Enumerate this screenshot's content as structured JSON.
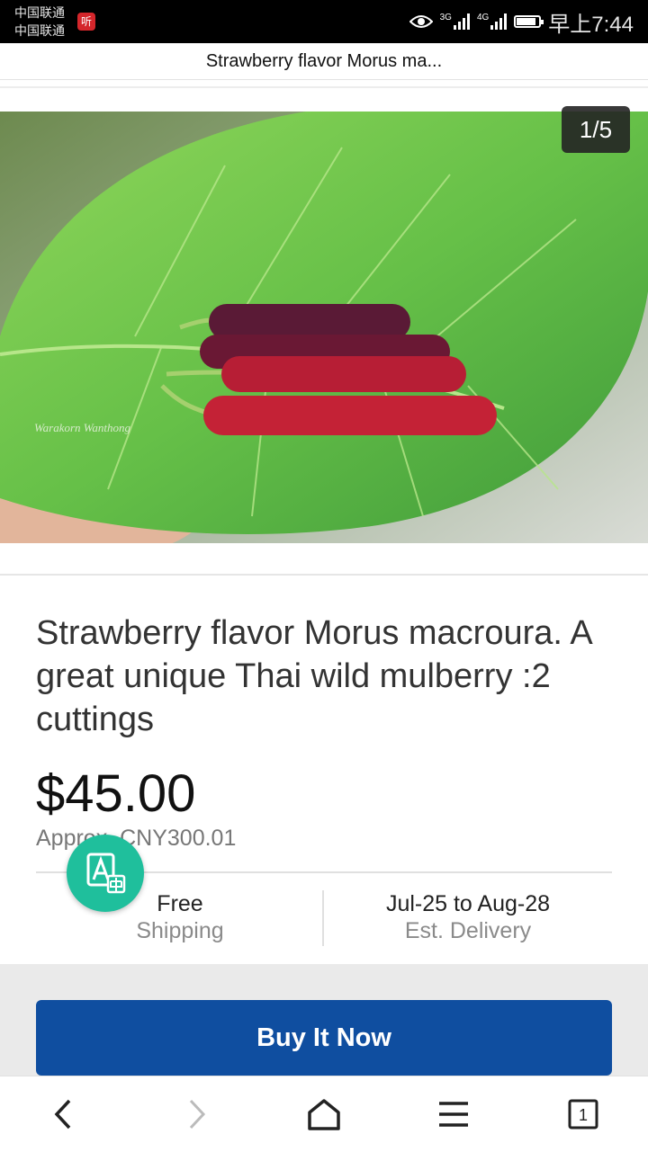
{
  "status_bar": {
    "carrier_1": "中国联通",
    "carrier_2": "中国联通",
    "listen_badge": "听",
    "network_1": "3G",
    "network_2": "4G",
    "time": "早上7:44",
    "battery_level": 0.85,
    "icons": [
      "eye-icon",
      "signal-icon",
      "battery-icon"
    ]
  },
  "header": {
    "title": "Strawberry flavor Morus ma..."
  },
  "gallery": {
    "counter": "1/5",
    "watermark": "Warakorn Wanthong"
  },
  "product": {
    "title": "Strawberry flavor Morus macroura. A great unique Thai wild mulberry :2 cuttings",
    "price": "$45.00",
    "approx_price": "Approx. CNY300.01"
  },
  "shipping": {
    "cost": "Free",
    "cost_label": "Shipping",
    "delivery": "Jul-25 to Aug-28",
    "delivery_label": "Est. Delivery"
  },
  "actions": {
    "buy_now": "Buy It Now"
  },
  "nav": {
    "tab_count": "1",
    "icons": [
      "back-icon",
      "forward-icon",
      "home-icon",
      "menu-icon",
      "tabs-icon"
    ]
  },
  "colors": {
    "buy_button": "#0f4ea0",
    "translate_fab": "#1fbf9c",
    "listen_badge": "#d4262b"
  }
}
